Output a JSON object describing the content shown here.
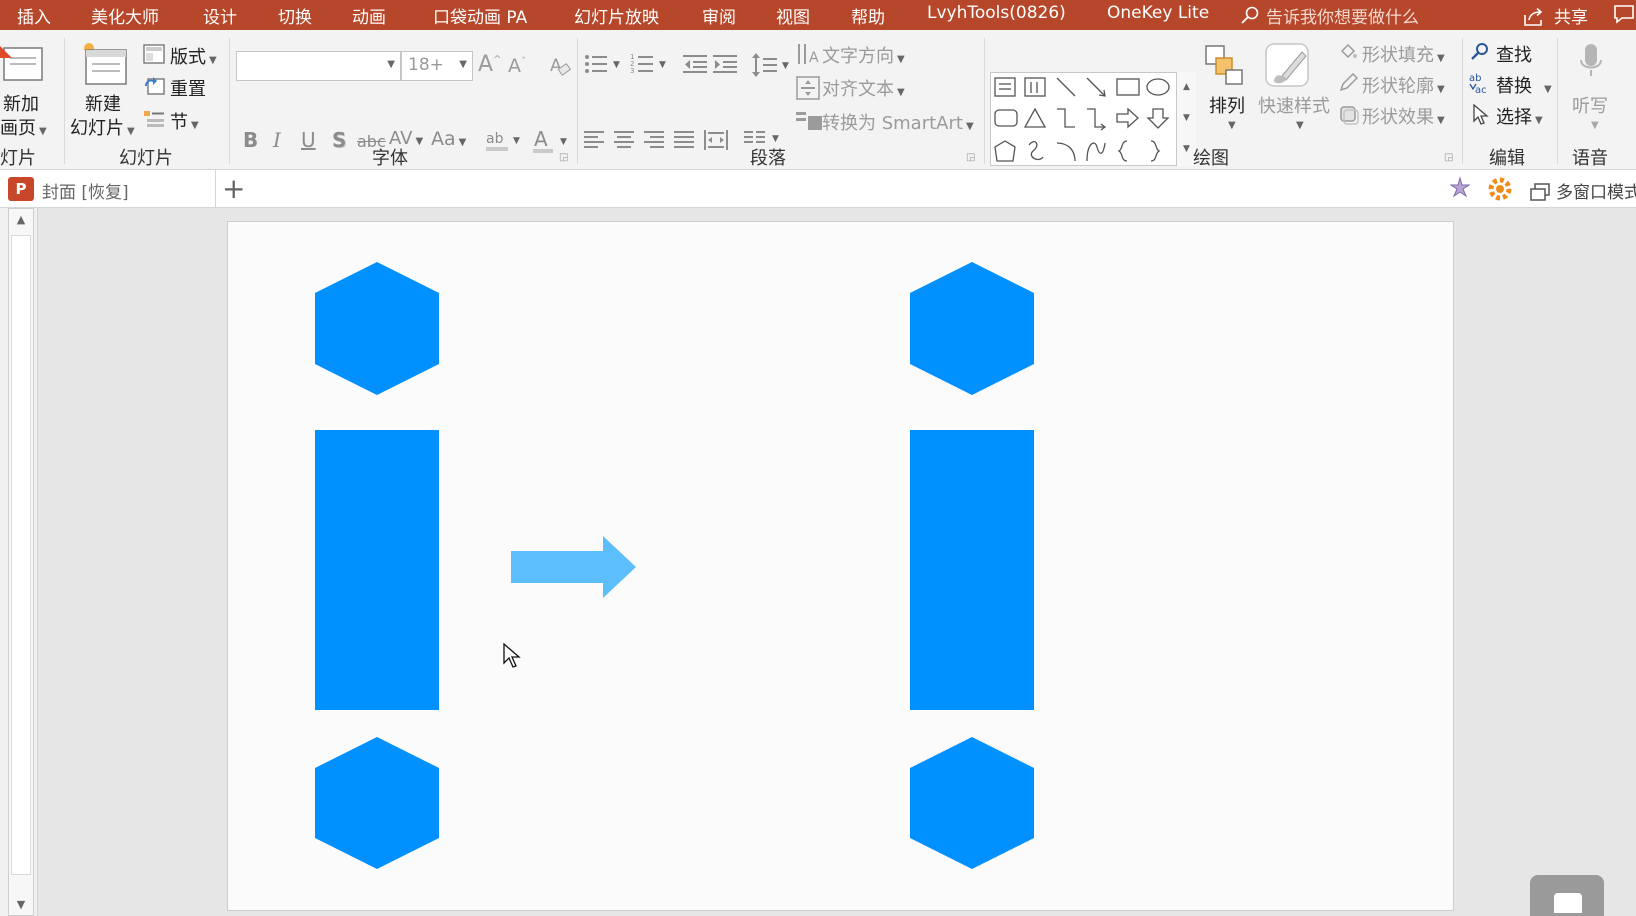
{
  "menubar": {
    "tabs": [
      "插入",
      "美化大师",
      "设计",
      "切换",
      "动画",
      "口袋动画 PA",
      "幻灯片放映",
      "审阅",
      "视图",
      "帮助",
      "LvyhTools(0826)",
      "OneKey Lite"
    ],
    "search_placeholder": "告诉我你想要做什么",
    "share_label": "共享"
  },
  "ribbon": {
    "slides": {
      "new_page_label": "新加",
      "new_page_label2": "画页",
      "new_slide_label": "新建",
      "new_slide_label2": "幻灯片",
      "layout_label": "版式",
      "reset_label": "重置",
      "section_label": "节",
      "group_label": "幻灯片",
      "cut_group_label": "灯片"
    },
    "font": {
      "font_name": "",
      "font_size": "18+",
      "group_label": "字体"
    },
    "paragraph": {
      "text_direction_label": "文字方向",
      "align_text_label": "对齐文本",
      "smartart_label": "转换为 SmartArt",
      "group_label": "段落"
    },
    "drawing": {
      "arrange_label": "排列",
      "quick_styles_label": "快速样式",
      "shape_fill_label": "形状填充",
      "shape_outline_label": "形状轮廓",
      "shape_effects_label": "形状效果",
      "group_label": "绘图"
    },
    "editing": {
      "find_label": "查找",
      "replace_label": "替换",
      "select_label": "选择",
      "group_label": "编辑"
    },
    "voice": {
      "dictate_label": "听写",
      "group_label": "语音"
    }
  },
  "doc_tabs": {
    "active_tab": "封面 [恢复]",
    "multi_window_label": "多窗口模式"
  },
  "colors": {
    "title_bar": "#b7472a",
    "shape_blue": "#0090ff",
    "arrow_light_blue": "#5cbffc"
  },
  "icons": [
    "search-icon",
    "share-icon",
    "comment-icon",
    "powerpoint-icon",
    "add-tab-icon",
    "magic-wand-icon",
    "gear-icon",
    "multi-window-icon",
    "microphone-icon",
    "cursor-icon"
  ]
}
